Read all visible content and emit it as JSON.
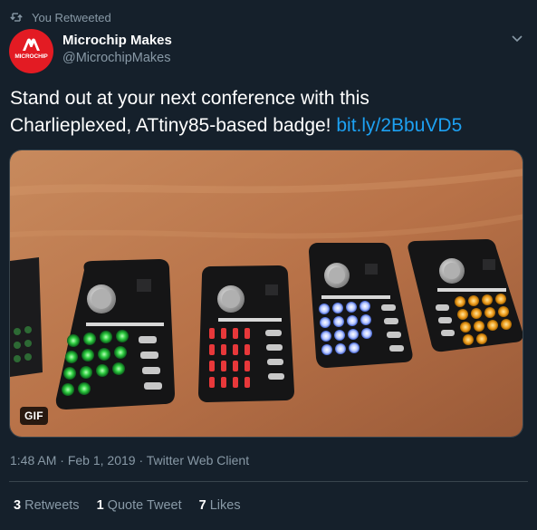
{
  "retweet": {
    "label": "You Retweeted",
    "icon": "retweet-icon"
  },
  "author": {
    "avatar_text": "MICROCHIP",
    "avatar_color": "#e31b23",
    "display_name": "Microchip Makes",
    "handle": "@MicrochipMakes"
  },
  "tweet": {
    "text_line1": "Stand out at your next conference with this",
    "text_line2": "Charlieplexed, ATtiny85-based badge! ",
    "link": "bit.ly/2BbuVD5",
    "link_color": "#1da1f2"
  },
  "media": {
    "badge": "GIF",
    "description_icon": "photo-of-led-badges"
  },
  "meta": {
    "time": "1:48 AM",
    "separator1": " · ",
    "date": "Feb 1, 2019",
    "separator2": " · ",
    "client": "Twitter Web Client"
  },
  "stats": {
    "retweets_count": "3",
    "retweets_label": "Retweets",
    "quotes_count": "1",
    "quotes_label": "Quote Tweet",
    "likes_count": "7",
    "likes_label": "Likes"
  },
  "colors": {
    "background": "#15202b",
    "secondary_text": "#8899a6",
    "border": "#38444d"
  }
}
